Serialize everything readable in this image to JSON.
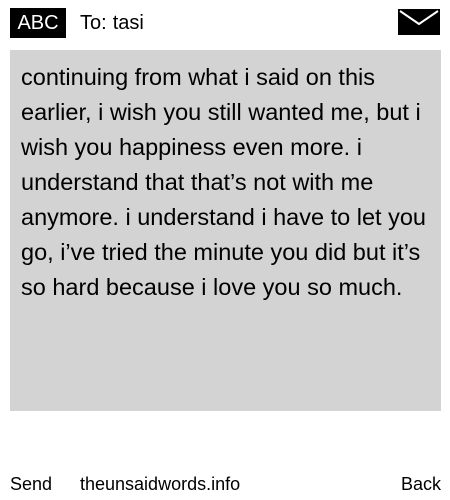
{
  "header": {
    "badge_label": "ABC",
    "to_label": "To:",
    "recipient": "tasi",
    "mail_icon": "envelope-icon"
  },
  "message": {
    "body": "continuing from what i said on this earlier, i wish you still wanted me, but i wish you happiness even more. i understand that that’s not with me anymore. i understand i have to let you go, i’ve tried the minute you did but it’s so hard because i love you so much.",
    "background_color": "#d3d3d3"
  },
  "footer": {
    "send_label": "Send",
    "site_label": "theunsaidwords.info",
    "back_label": "Back"
  }
}
